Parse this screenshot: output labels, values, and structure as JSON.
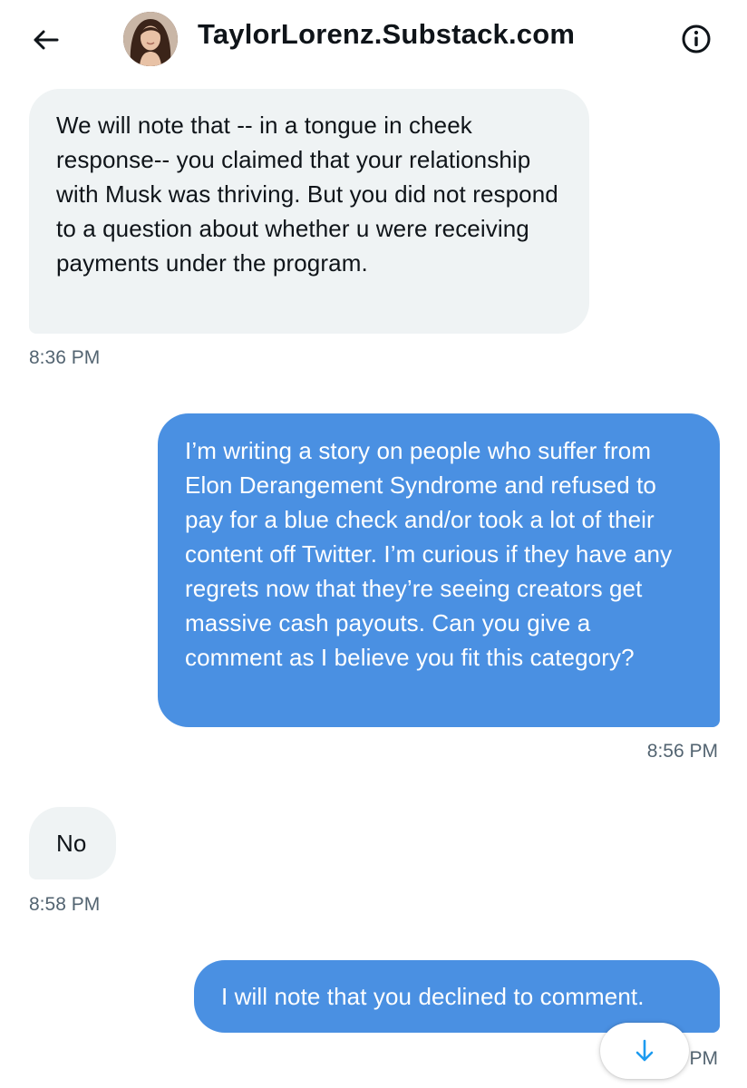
{
  "header": {
    "title": "TaylorLorenz.Substack.com"
  },
  "messages": [
    {
      "direction": "in",
      "text": "We will note that -- in a tongue in cheek response-- you claimed that your relationship with Musk was thriving. But you did not respond to a question about whether u were receiving payments under the program.",
      "time": "8:36 PM"
    },
    {
      "direction": "out",
      "text": "I’m writing a story on people who suffer from Elon Derangement Syndrome and refused to pay for a blue check and/or took a lot of their content off Twitter. I’m curious if they have any regrets now that they’re seeing creators get massive cash payouts. Can you give a comment as I believe you fit this category?",
      "time": "8:56 PM"
    },
    {
      "direction": "in",
      "text": "No",
      "time": "8:58 PM"
    },
    {
      "direction": "out",
      "text": "I will note that you declined to comment.",
      "time": "PM"
    }
  ],
  "colors": {
    "outgoing_bubble": "#4a90e2",
    "incoming_bubble": "#eff3f4",
    "timestamp": "#536471",
    "accent": "#1d9bf0"
  },
  "icons": {
    "back": "arrow-left-icon",
    "info": "info-circle-icon",
    "scroll": "arrow-down-icon"
  }
}
